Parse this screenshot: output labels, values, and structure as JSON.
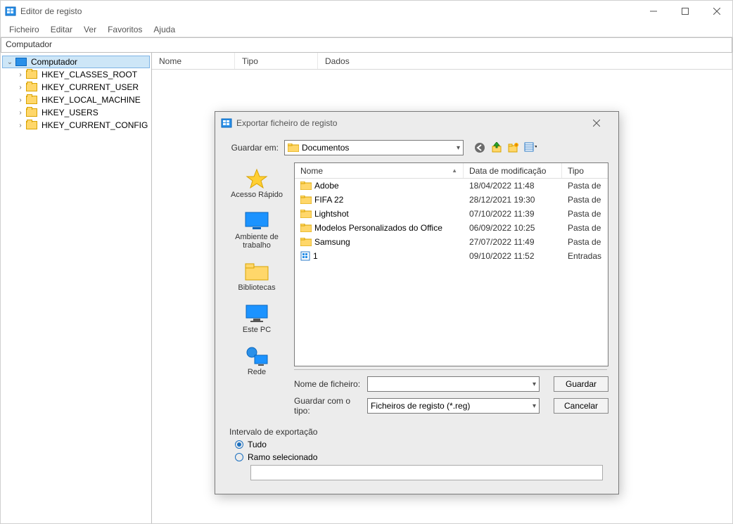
{
  "app": {
    "title": "Editor de registo",
    "menu": [
      "Ficheiro",
      "Editar",
      "Ver",
      "Favoritos",
      "Ajuda"
    ],
    "address": "Computador",
    "list_headers": {
      "name": "Nome",
      "type": "Tipo",
      "data": "Dados"
    },
    "tree": {
      "root": "Computador",
      "children": [
        "HKEY_CLASSES_ROOT",
        "HKEY_CURRENT_USER",
        "HKEY_LOCAL_MACHINE",
        "HKEY_USERS",
        "HKEY_CURRENT_CONFIG"
      ]
    }
  },
  "dialog": {
    "title": "Exportar ficheiro de registo",
    "save_in_label": "Guardar em:",
    "save_in_value": "Documentos",
    "shortcuts": [
      "Acesso Rápido",
      "Ambiente de trabalho",
      "Bibliotecas",
      "Este PC",
      "Rede"
    ],
    "file_headers": {
      "name": "Nome",
      "date": "Data de modificação",
      "type": "Tipo"
    },
    "files": [
      {
        "icon": "folder",
        "name": "Adobe",
        "date": "18/04/2022 11:48",
        "type": "Pasta de"
      },
      {
        "icon": "folder",
        "name": "FIFA 22",
        "date": "28/12/2021 19:30",
        "type": "Pasta de"
      },
      {
        "icon": "folder",
        "name": "Lightshot",
        "date": "07/10/2022 11:39",
        "type": "Pasta de"
      },
      {
        "icon": "folder",
        "name": "Modelos Personalizados do Office",
        "date": "06/09/2022 10:25",
        "type": "Pasta de"
      },
      {
        "icon": "folder",
        "name": "Samsung",
        "date": "27/07/2022 11:49",
        "type": "Pasta de"
      },
      {
        "icon": "reg",
        "name": "1",
        "date": "09/10/2022 11:52",
        "type": "Entradas"
      }
    ],
    "filename_label": "Nome de ficheiro:",
    "filename_value": "",
    "savetype_label": "Guardar com o tipo:",
    "savetype_value": "Ficheiros de registo (*.reg)",
    "save_button": "Guardar",
    "cancel_button": "Cancelar",
    "range_title": "Intervalo de exportação",
    "range_all": "Tudo",
    "range_branch": "Ramo selecionado",
    "range_selected": "all"
  }
}
